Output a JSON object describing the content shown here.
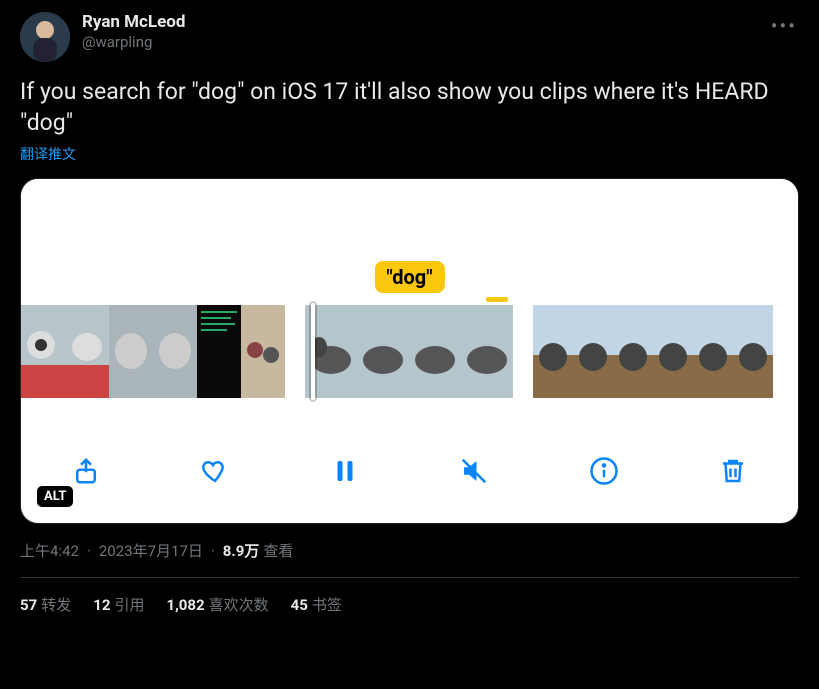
{
  "author": {
    "display_name": "Ryan McLeod",
    "handle": "@warpling"
  },
  "tweet_text": "If you search for \"dog\" on iOS 17 it'll also show you clips where it's HEARD \"dog\"",
  "translate_label": "翻译推文",
  "media": {
    "caption": "\"dog\"",
    "alt_badge": "ALT"
  },
  "meta": {
    "time": "上午4:42",
    "date": "2023年7月17日",
    "views_number": "8.9万",
    "views_label": "查看"
  },
  "stats": {
    "retweets_num": "57",
    "retweets_label": "转发",
    "quotes_num": "12",
    "quotes_label": "引用",
    "likes_num": "1,082",
    "likes_label": "喜欢次数",
    "bookmarks_num": "45",
    "bookmarks_label": "书签"
  }
}
